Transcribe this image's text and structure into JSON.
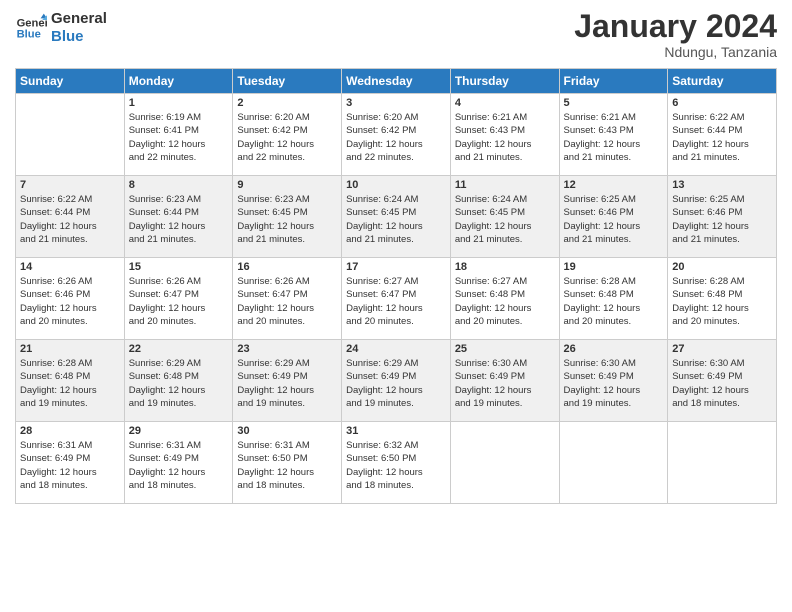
{
  "logo": {
    "line1": "General",
    "line2": "Blue"
  },
  "title": "January 2024",
  "location": "Ndungu, Tanzania",
  "days_of_week": [
    "Sunday",
    "Monday",
    "Tuesday",
    "Wednesday",
    "Thursday",
    "Friday",
    "Saturday"
  ],
  "weeks": [
    [
      {
        "day": "",
        "info": ""
      },
      {
        "day": "1",
        "info": "Sunrise: 6:19 AM\nSunset: 6:41 PM\nDaylight: 12 hours\nand 22 minutes."
      },
      {
        "day": "2",
        "info": "Sunrise: 6:20 AM\nSunset: 6:42 PM\nDaylight: 12 hours\nand 22 minutes."
      },
      {
        "day": "3",
        "info": "Sunrise: 6:20 AM\nSunset: 6:42 PM\nDaylight: 12 hours\nand 22 minutes."
      },
      {
        "day": "4",
        "info": "Sunrise: 6:21 AM\nSunset: 6:43 PM\nDaylight: 12 hours\nand 21 minutes."
      },
      {
        "day": "5",
        "info": "Sunrise: 6:21 AM\nSunset: 6:43 PM\nDaylight: 12 hours\nand 21 minutes."
      },
      {
        "day": "6",
        "info": "Sunrise: 6:22 AM\nSunset: 6:44 PM\nDaylight: 12 hours\nand 21 minutes."
      }
    ],
    [
      {
        "day": "7",
        "info": "Sunrise: 6:22 AM\nSunset: 6:44 PM\nDaylight: 12 hours\nand 21 minutes."
      },
      {
        "day": "8",
        "info": "Sunrise: 6:23 AM\nSunset: 6:44 PM\nDaylight: 12 hours\nand 21 minutes."
      },
      {
        "day": "9",
        "info": "Sunrise: 6:23 AM\nSunset: 6:45 PM\nDaylight: 12 hours\nand 21 minutes."
      },
      {
        "day": "10",
        "info": "Sunrise: 6:24 AM\nSunset: 6:45 PM\nDaylight: 12 hours\nand 21 minutes."
      },
      {
        "day": "11",
        "info": "Sunrise: 6:24 AM\nSunset: 6:45 PM\nDaylight: 12 hours\nand 21 minutes."
      },
      {
        "day": "12",
        "info": "Sunrise: 6:25 AM\nSunset: 6:46 PM\nDaylight: 12 hours\nand 21 minutes."
      },
      {
        "day": "13",
        "info": "Sunrise: 6:25 AM\nSunset: 6:46 PM\nDaylight: 12 hours\nand 21 minutes."
      }
    ],
    [
      {
        "day": "14",
        "info": "Sunrise: 6:26 AM\nSunset: 6:46 PM\nDaylight: 12 hours\nand 20 minutes."
      },
      {
        "day": "15",
        "info": "Sunrise: 6:26 AM\nSunset: 6:47 PM\nDaylight: 12 hours\nand 20 minutes."
      },
      {
        "day": "16",
        "info": "Sunrise: 6:26 AM\nSunset: 6:47 PM\nDaylight: 12 hours\nand 20 minutes."
      },
      {
        "day": "17",
        "info": "Sunrise: 6:27 AM\nSunset: 6:47 PM\nDaylight: 12 hours\nand 20 minutes."
      },
      {
        "day": "18",
        "info": "Sunrise: 6:27 AM\nSunset: 6:48 PM\nDaylight: 12 hours\nand 20 minutes."
      },
      {
        "day": "19",
        "info": "Sunrise: 6:28 AM\nSunset: 6:48 PM\nDaylight: 12 hours\nand 20 minutes."
      },
      {
        "day": "20",
        "info": "Sunrise: 6:28 AM\nSunset: 6:48 PM\nDaylight: 12 hours\nand 20 minutes."
      }
    ],
    [
      {
        "day": "21",
        "info": "Sunrise: 6:28 AM\nSunset: 6:48 PM\nDaylight: 12 hours\nand 19 minutes."
      },
      {
        "day": "22",
        "info": "Sunrise: 6:29 AM\nSunset: 6:48 PM\nDaylight: 12 hours\nand 19 minutes."
      },
      {
        "day": "23",
        "info": "Sunrise: 6:29 AM\nSunset: 6:49 PM\nDaylight: 12 hours\nand 19 minutes."
      },
      {
        "day": "24",
        "info": "Sunrise: 6:29 AM\nSunset: 6:49 PM\nDaylight: 12 hours\nand 19 minutes."
      },
      {
        "day": "25",
        "info": "Sunrise: 6:30 AM\nSunset: 6:49 PM\nDaylight: 12 hours\nand 19 minutes."
      },
      {
        "day": "26",
        "info": "Sunrise: 6:30 AM\nSunset: 6:49 PM\nDaylight: 12 hours\nand 19 minutes."
      },
      {
        "day": "27",
        "info": "Sunrise: 6:30 AM\nSunset: 6:49 PM\nDaylight: 12 hours\nand 18 minutes."
      }
    ],
    [
      {
        "day": "28",
        "info": "Sunrise: 6:31 AM\nSunset: 6:49 PM\nDaylight: 12 hours\nand 18 minutes."
      },
      {
        "day": "29",
        "info": "Sunrise: 6:31 AM\nSunset: 6:49 PM\nDaylight: 12 hours\nand 18 minutes."
      },
      {
        "day": "30",
        "info": "Sunrise: 6:31 AM\nSunset: 6:50 PM\nDaylight: 12 hours\nand 18 minutes."
      },
      {
        "day": "31",
        "info": "Sunrise: 6:32 AM\nSunset: 6:50 PM\nDaylight: 12 hours\nand 18 minutes."
      },
      {
        "day": "",
        "info": ""
      },
      {
        "day": "",
        "info": ""
      },
      {
        "day": "",
        "info": ""
      }
    ]
  ]
}
